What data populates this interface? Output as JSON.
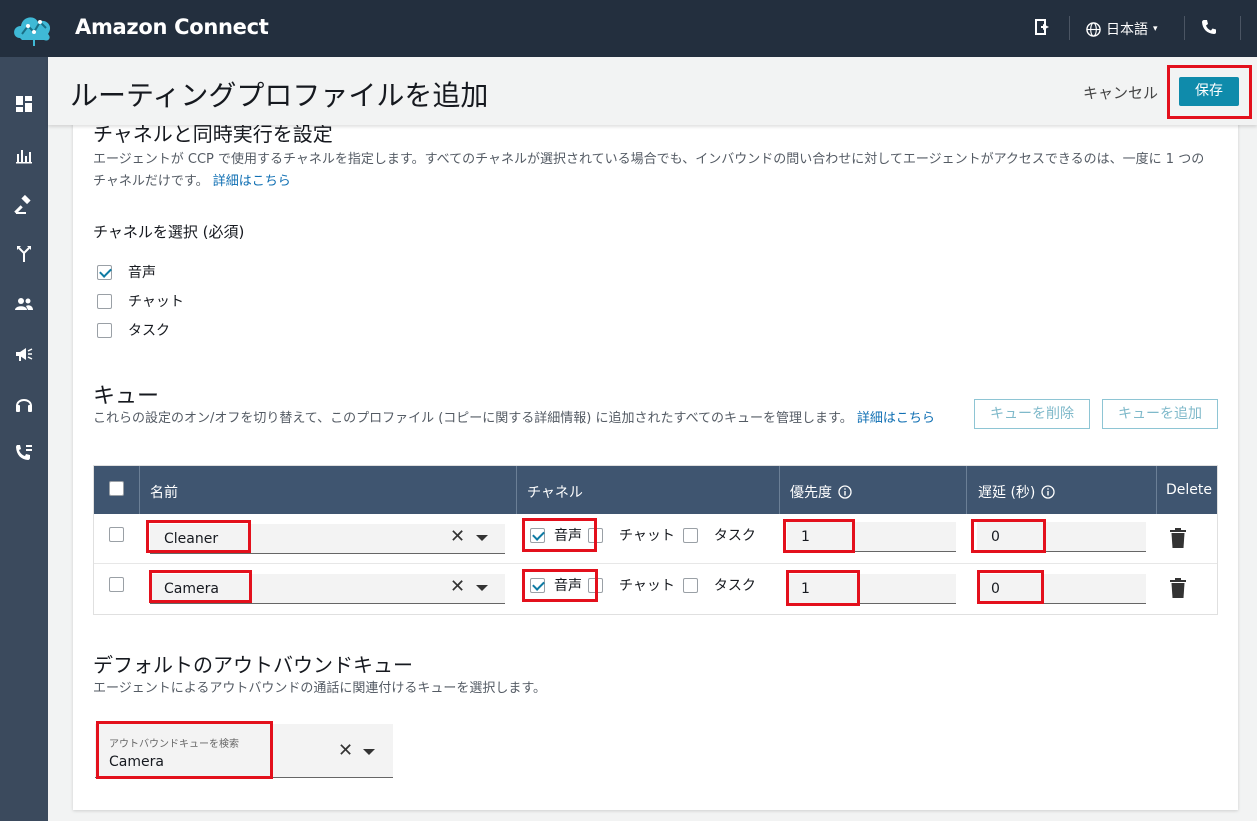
{
  "app": {
    "title": "Amazon Connect",
    "language": "日本語"
  },
  "page": {
    "title": "ルーティングプロファイルを追加",
    "cancel_label": "キャンセル",
    "save_label": "保存"
  },
  "channels_section": {
    "title": "チャネルと同時実行を設定",
    "description_line1": "エージェントが CCP で使用するチャネルを指定します。すべてのチャネルが選択されている場合でも、インバウンドの問い合わせに対してエージェントがアクセスできるのは、一度に 1 つの",
    "description_line2": "チャネルだけです。",
    "details_link": "詳細はこちら",
    "select_label": "チャネルを選択 (必須)",
    "options": [
      {
        "label": "音声",
        "checked": true
      },
      {
        "label": "チャット",
        "checked": false
      },
      {
        "label": "タスク",
        "checked": false
      }
    ]
  },
  "queues_section": {
    "title": "キュー",
    "description": "これらの設定のオン/オフを切り替えて、このプロファイル (コピーに関する詳細情報) に追加されたすべてのキューを管理します。",
    "details_link": "詳細はこちら",
    "delete_button": "キューを削除",
    "add_button": "キューを追加",
    "columns": {
      "name": "名前",
      "channel": "チャネル",
      "priority": "優先度",
      "delay": "遅延 (秒)",
      "delete": "Delete"
    },
    "rows": [
      {
        "name": "Cleaner",
        "voice": "音声",
        "chat": "チャット",
        "task": "タスク",
        "priority": "1",
        "delay": "0"
      },
      {
        "name": "Camera",
        "voice": "音声",
        "chat": "チャット",
        "task": "タスク",
        "priority": "1",
        "delay": "0"
      }
    ]
  },
  "outbound_section": {
    "title": "デフォルトのアウトバウンドキュー",
    "description": "エージェントによるアウトバウンドの通話に関連付けるキューを選択します。",
    "search_placeholder": "アウトバウンドキューを検索",
    "value": "Camera"
  },
  "colors": {
    "topbar": "#232f3e",
    "sidebar": "#3b4a5d",
    "accent": "#0f8bab",
    "table_header": "#3f5570",
    "highlight": "#e3101c"
  }
}
